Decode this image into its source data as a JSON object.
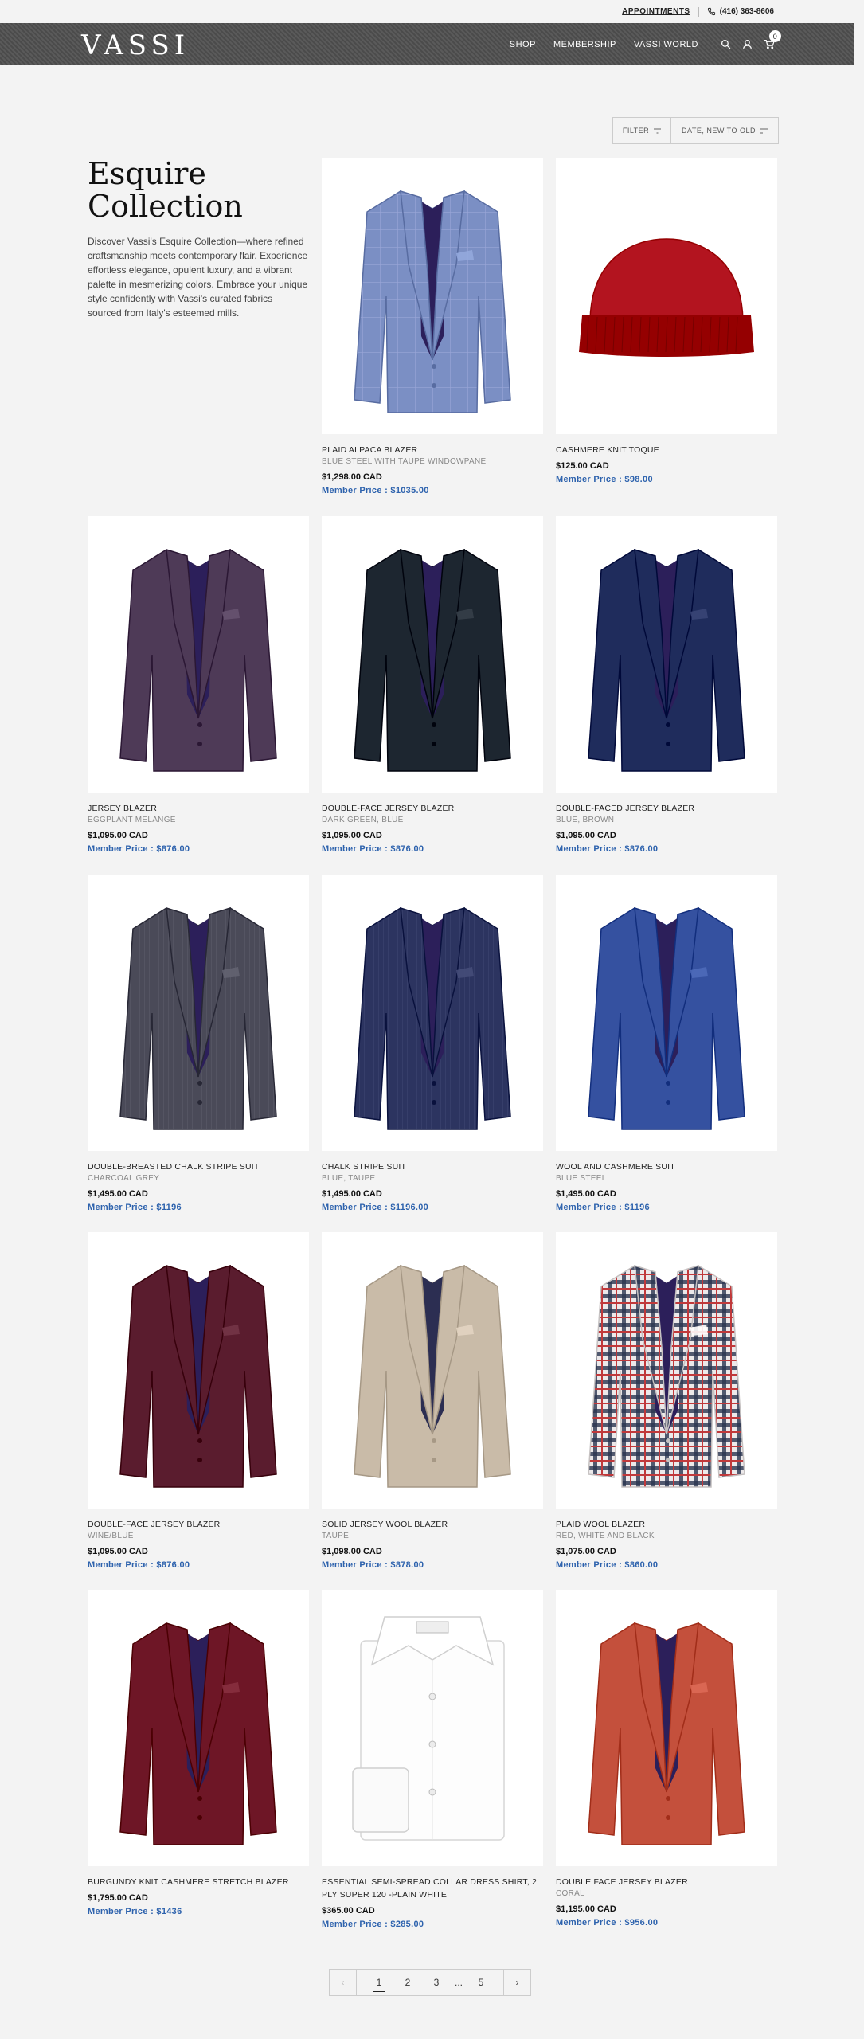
{
  "utility": {
    "appointments": "APPOINTMENTS",
    "phone": "(416) 363-8606"
  },
  "header": {
    "logo": "VASSI",
    "nav": [
      "SHOP",
      "MEMBERSHIP",
      "VASSI WORLD"
    ],
    "cart_count": "0"
  },
  "toolbar": {
    "filter": "FILTER",
    "sort": "DATE, NEW TO OLD"
  },
  "collection": {
    "title_line1": "Esquire",
    "title_line2": "Collection",
    "description": "Discover Vassi's Esquire Collection—where refined craftsmanship meets contemporary flair. Experience effortless elegance, opulent luxury, and a vibrant palette in mesmerizing colors. Embrace your unique style confidently with Vassi's curated fabrics sourced from Italy's esteemed mills."
  },
  "products": [
    {
      "name": "PLAID ALPACA BLAZER",
      "color": "BLUE STEEL WITH TAUPE WINDOWPANE",
      "price": "$1,298.00 CAD",
      "member": "Member Price : $1035.00",
      "kind": "jacket",
      "hex": "#7b8fc4",
      "pattern": "check"
    },
    {
      "name": "CASHMERE KNIT TOQUE",
      "color": "",
      "price": "$125.00 CAD",
      "member": "Member Price : $98.00",
      "kind": "toque",
      "hex": "#b3141f"
    },
    {
      "name": "JERSEY BLAZER",
      "color": "EGGPLANT MELANGE",
      "price": "$1,095.00 CAD",
      "member": "Member Price : $876.00",
      "kind": "jacket",
      "hex": "#4e3a57",
      "pattern": "none"
    },
    {
      "name": "DOUBLE-FACE JERSEY BLAZER",
      "color": "DARK GREEN, BLUE",
      "price": "$1,095.00 CAD",
      "member": "Member Price : $876.00",
      "kind": "jacket",
      "hex": "#1d2630",
      "pattern": "none"
    },
    {
      "name": "DOUBLE-FACED JERSEY BLAZER",
      "color": "BLUE, BROWN",
      "price": "$1,095.00 CAD",
      "member": "Member Price : $876.00",
      "kind": "jacket",
      "hex": "#1f2c5c",
      "pattern": "none"
    },
    {
      "name": "DOUBLE-BREASTED CHALK STRIPE SUIT",
      "color": "CHARCOAL GREY",
      "price": "$1,495.00 CAD",
      "member": "Member Price : $1196",
      "kind": "jacket",
      "hex": "#4a4a58",
      "pattern": "stripe"
    },
    {
      "name": "CHALK STRIPE SUIT",
      "color": "BLUE, TAUPE",
      "price": "$1,495.00 CAD",
      "member": "Member Price : $1196.00",
      "kind": "jacket",
      "hex": "#2c3460",
      "pattern": "stripe"
    },
    {
      "name": "WOOL AND CASHMERE SUIT",
      "color": "BLUE STEEL",
      "price": "$1,495.00 CAD",
      "member": "Member Price : $1196",
      "kind": "jacket",
      "hex": "#3551a0",
      "pattern": "none"
    },
    {
      "name": "DOUBLE-FACE JERSEY BLAZER",
      "color": "WINE/BLUE",
      "price": "$1,095.00 CAD",
      "member": "Member Price : $876.00",
      "kind": "jacket",
      "hex": "#5a1c2e",
      "pattern": "none"
    },
    {
      "name": "SOLID JERSEY WOOL BLAZER",
      "color": "TAUPE",
      "price": "$1,098.00 CAD",
      "member": "Member Price : $878.00",
      "kind": "jacket",
      "hex": "#c9bba8",
      "pattern": "none"
    },
    {
      "name": "PLAID WOOL BLAZER",
      "color": "RED, WHITE AND BLACK",
      "price": "$1,075.00 CAD",
      "member": "Member Price : $860.00",
      "kind": "jacket",
      "hex": "#e8e4e4",
      "pattern": "plaid"
    },
    {
      "name": "BURGUNDY KNIT CASHMERE STRETCH BLAZER",
      "color": "",
      "price": "$1,795.00 CAD",
      "member": "Member Price : $1436",
      "kind": "jacket",
      "hex": "#6e1626",
      "pattern": "none"
    },
    {
      "name": "ESSENTIAL SEMI-SPREAD COLLAR DRESS SHIRT, 2 PLY SUPER 120 -PLAIN WHITE",
      "color": "",
      "price": "$365.00 CAD",
      "member": "Member Price : $285.00",
      "kind": "shirt",
      "hex": "#fafafa"
    },
    {
      "name": "DOUBLE FACE JERSEY BLAZER",
      "color": "CORAL",
      "price": "$1,195.00 CAD",
      "member": "Member Price : $956.00",
      "kind": "jacket",
      "hex": "#c4503c",
      "pattern": "none"
    }
  ],
  "pagination": {
    "prev": "‹",
    "next": "›",
    "pages": [
      "1",
      "2",
      "3",
      "5"
    ],
    "dots": "...",
    "current": "1"
  }
}
